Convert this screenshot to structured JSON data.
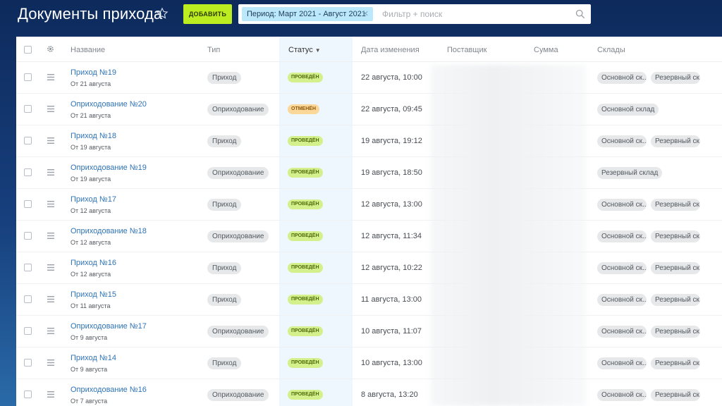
{
  "header": {
    "title": "Документы прихода",
    "add_label": "Добавить",
    "filter_chip": "Период: Март 2021 - Август 2021",
    "search_placeholder": "Фильтр + поиск"
  },
  "table": {
    "columns": {
      "name": "Название",
      "type": "Тип",
      "status": "Статус",
      "modified": "Дата изменения",
      "supplier": "Поставщик",
      "sum": "Сумма",
      "warehouses": "Склады"
    },
    "rows": [
      {
        "name": "Приход №19",
        "date": "От 21 августа",
        "type": "Приход",
        "status": "Проведён",
        "status_kind": "ok",
        "modified": "22 августа, 10:00",
        "wh1": "Основной ск...",
        "wh2": "Резервный ск..."
      },
      {
        "name": "Оприходование №20",
        "date": "От 21 августа",
        "type": "Оприходование",
        "status": "Отменён",
        "status_kind": "cancel",
        "modified": "22 августа, 09:45",
        "wh1": "Основной склад",
        "wh2": ""
      },
      {
        "name": "Приход №18",
        "date": "От 19 августа",
        "type": "Приход",
        "status": "Проведён",
        "status_kind": "ok",
        "modified": "19 августа, 19:12",
        "wh1": "Основной ск...",
        "wh2": "Резервный ск..."
      },
      {
        "name": "Оприходование №19",
        "date": "От 19 августа",
        "type": "Оприходование",
        "status": "Проведён",
        "status_kind": "ok",
        "modified": "19 августа, 18:50",
        "wh1": "Резервный склад",
        "wh2": ""
      },
      {
        "name": "Приход №17",
        "date": "От 12 августа",
        "type": "Приход",
        "status": "Проведён",
        "status_kind": "ok",
        "modified": "12 августа, 13:00",
        "wh1": "Основной ск...",
        "wh2": "Резервный ск..."
      },
      {
        "name": "Оприходование №18",
        "date": "От 12 августа",
        "type": "Оприходование",
        "status": "Проведён",
        "status_kind": "ok",
        "modified": "12 августа, 11:34",
        "wh1": "Основной ск...",
        "wh2": "Резервный ск..."
      },
      {
        "name": "Приход №16",
        "date": "От 12 августа",
        "type": "Приход",
        "status": "Проведён",
        "status_kind": "ok",
        "modified": "12 августа, 10:22",
        "wh1": "Основной ск...",
        "wh2": "Резервный ск..."
      },
      {
        "name": "Приход №15",
        "date": "От 11 августа",
        "type": "Приход",
        "status": "Проведён",
        "status_kind": "ok",
        "modified": "11 августа, 13:00",
        "wh1": "Основной ск...",
        "wh2": "Резервный ск..."
      },
      {
        "name": "Оприходование №17",
        "date": "От 9 августа",
        "type": "Оприходование",
        "status": "Проведён",
        "status_kind": "ok",
        "modified": "10 августа, 11:07",
        "wh1": "Основной ск...",
        "wh2": "Резервный ск..."
      },
      {
        "name": "Приход №14",
        "date": "От 9 августа",
        "type": "Приход",
        "status": "Проведён",
        "status_kind": "ok",
        "modified": "10 августа, 13:00",
        "wh1": "Основной ск...",
        "wh2": "Резервный ск..."
      },
      {
        "name": "Оприходование №16",
        "date": "От 7 августа",
        "type": "Оприходование",
        "status": "Проведён",
        "status_kind": "ok",
        "modified": "8 августа, 13:20",
        "wh1": "Основной ск...",
        "wh2": "Резервный ск..."
      }
    ]
  }
}
